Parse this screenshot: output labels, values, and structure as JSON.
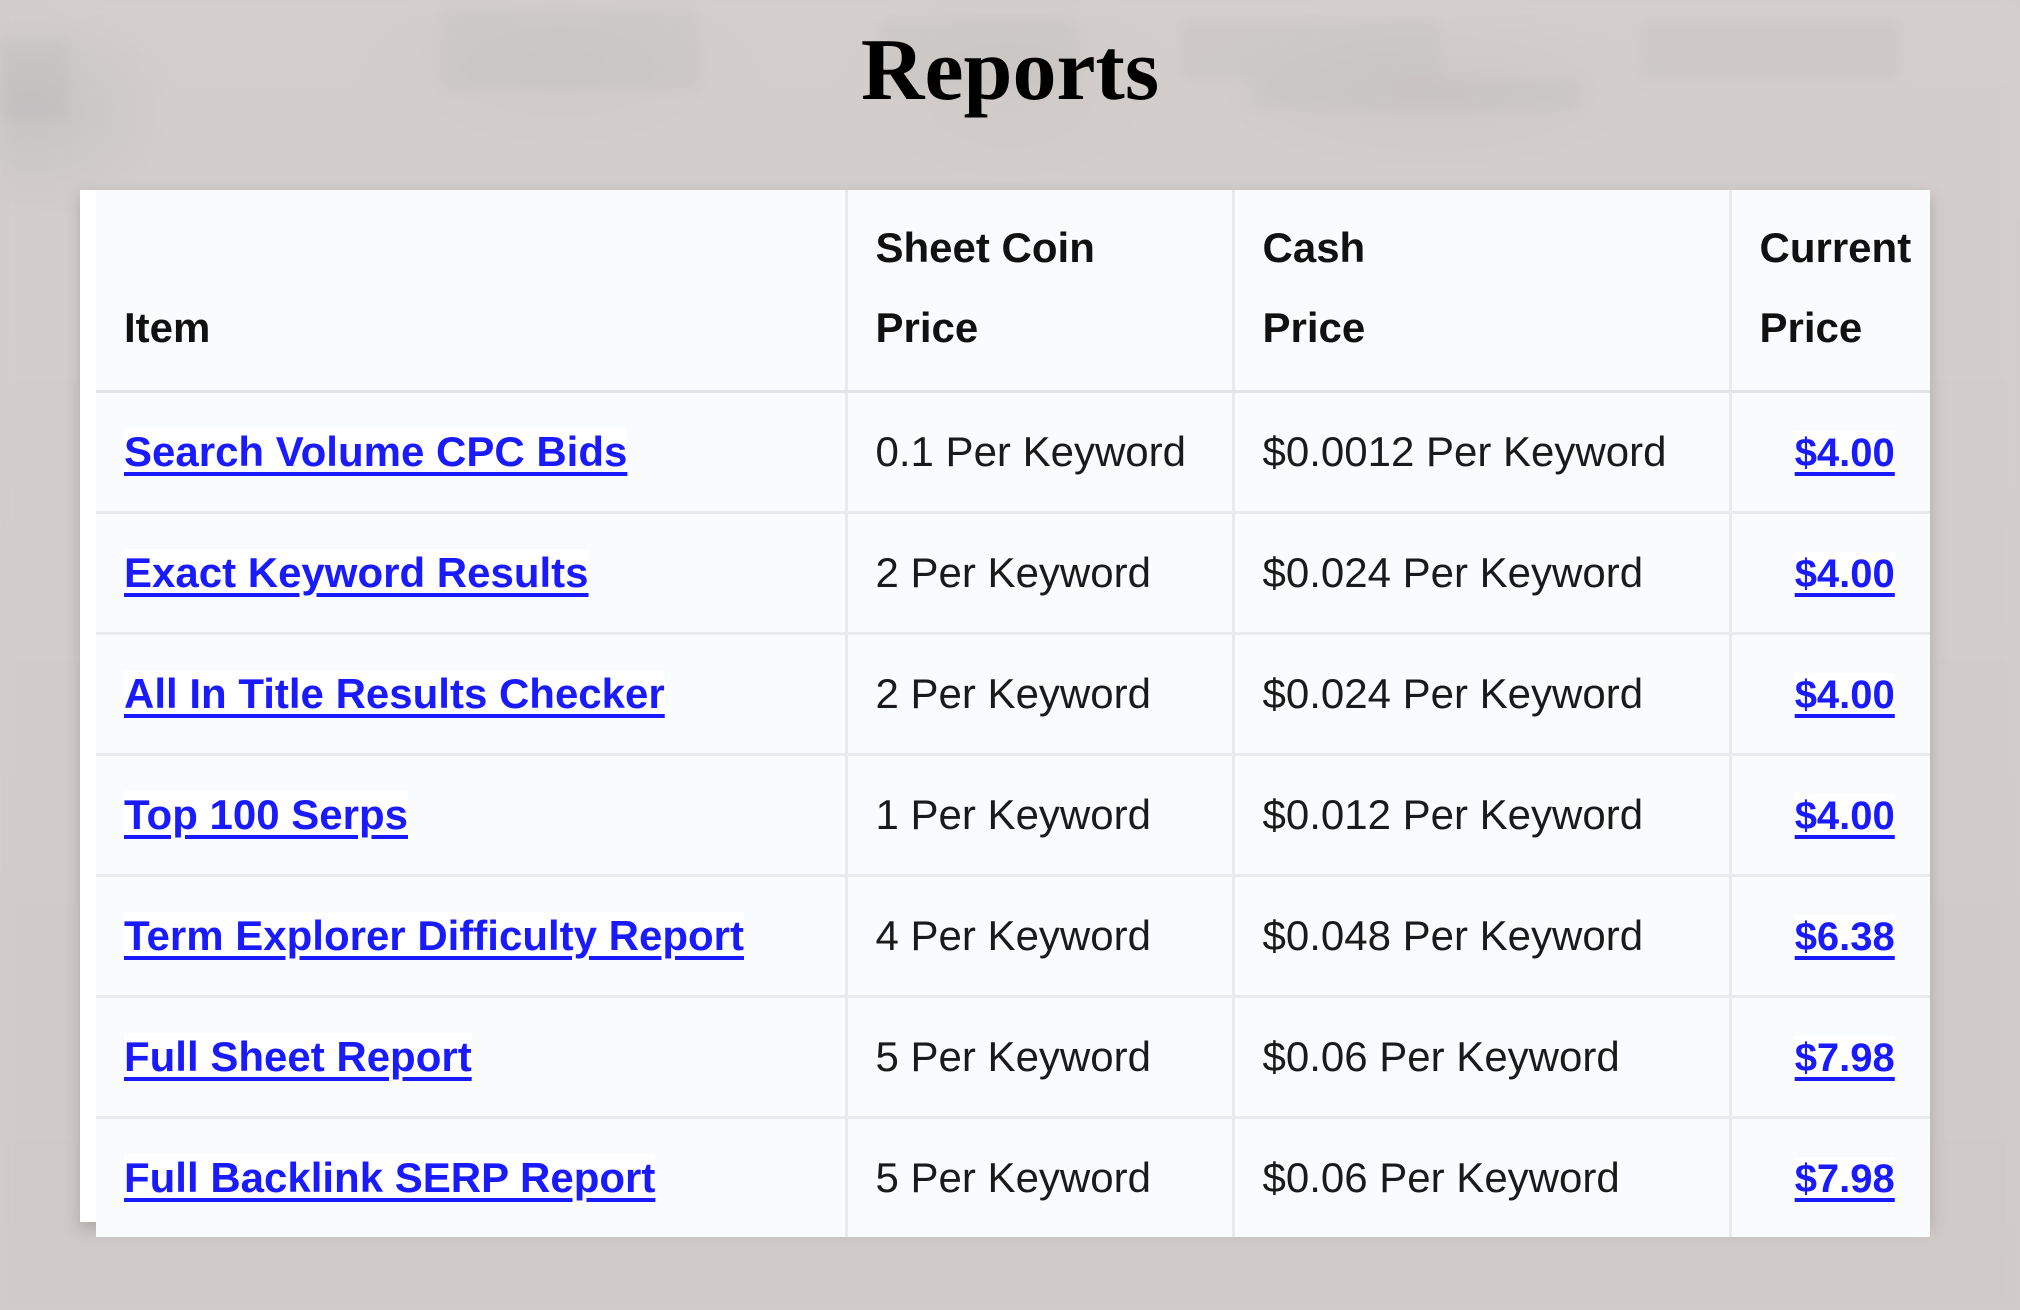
{
  "page": {
    "title": "Reports",
    "link_color": "#1a1aff",
    "background_color": "#d2cdcb",
    "card_color": "#ffffff",
    "cell_color": "#fafbfc"
  },
  "table": {
    "columns": [
      {
        "id": "item",
        "lines": [
          "Item"
        ]
      },
      {
        "id": "sheet",
        "lines": [
          "Sheet Coin",
          "Price"
        ]
      },
      {
        "id": "cash",
        "lines": [
          "Cash",
          "Price"
        ]
      },
      {
        "id": "current",
        "lines": [
          "Current",
          "Price"
        ]
      }
    ],
    "rows": [
      {
        "item": "Search Volume CPC Bids",
        "sheet_coin_price": "0.1 Per Keyword",
        "cash_price": "$0.0012 Per Keyword",
        "current_price": "$4.00"
      },
      {
        "item": "Exact Keyword Results",
        "sheet_coin_price": "2 Per Keyword",
        "cash_price": "$0.024 Per Keyword",
        "current_price": "$4.00"
      },
      {
        "item": "All In Title Results Checker",
        "sheet_coin_price": "2 Per Keyword",
        "cash_price": "$0.024 Per Keyword",
        "current_price": "$4.00"
      },
      {
        "item": "Top 100 Serps",
        "sheet_coin_price": "1 Per Keyword",
        "cash_price": "$0.012 Per Keyword",
        "current_price": "$4.00"
      },
      {
        "item": "Term Explorer Difficulty Report",
        "sheet_coin_price": "4 Per Keyword",
        "cash_price": "$0.048 Per Keyword",
        "current_price": "$6.38"
      },
      {
        "item": "Full Sheet Report",
        "sheet_coin_price": "5 Per Keyword",
        "cash_price": "$0.06 Per Keyword",
        "current_price": "$7.98"
      },
      {
        "item": "Full Backlink SERP Report",
        "sheet_coin_price": "5 Per Keyword",
        "cash_price": "$0.06 Per Keyword",
        "current_price": "$7.98"
      }
    ]
  }
}
